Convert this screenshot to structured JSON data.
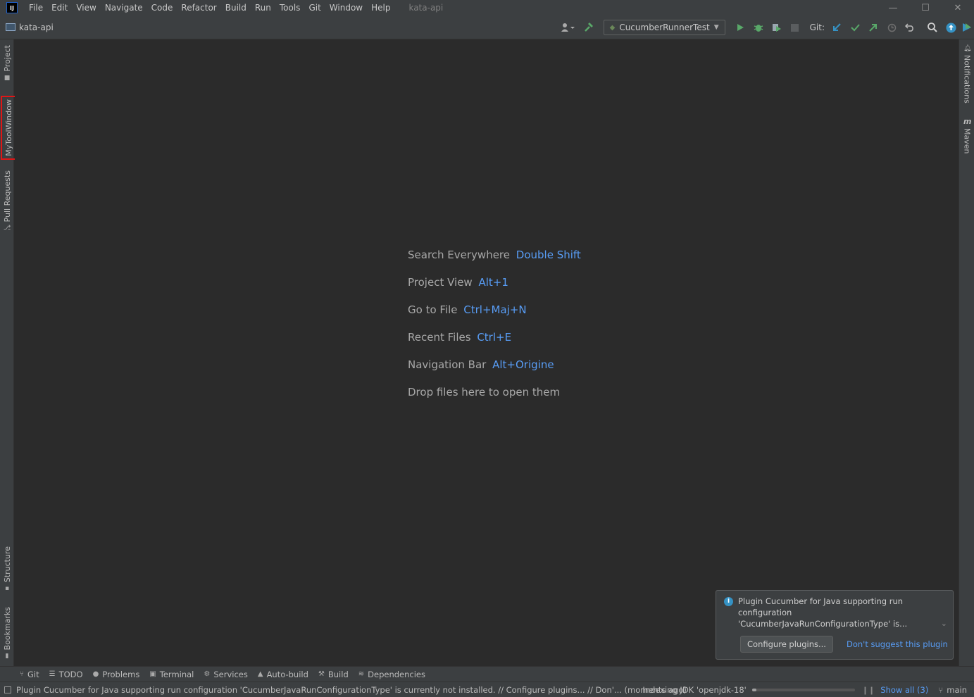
{
  "app": {
    "logo": "IJ",
    "title": "kata-api"
  },
  "menu": [
    "File",
    "Edit",
    "View",
    "Navigate",
    "Code",
    "Refactor",
    "Build",
    "Run",
    "Tools",
    "Git",
    "Window",
    "Help"
  ],
  "window_controls": {
    "minimize": "—",
    "maximize": "☐",
    "close": "✕"
  },
  "navbar": {
    "project": "kata-api",
    "run_config": "CucumberRunnerTest",
    "git_label": "Git:"
  },
  "left_stripe": {
    "project": "Project",
    "mytoolwindow": "MyToolWindow",
    "pull_requests": "Pull Requests",
    "structure": "Structure",
    "bookmarks": "Bookmarks"
  },
  "right_stripe": {
    "notifications": "Notifications",
    "maven": "Maven",
    "maven_glyph": "m"
  },
  "hints": [
    {
      "label": "Search Everywhere",
      "key": "Double Shift"
    },
    {
      "label": "Project View",
      "key": "Alt+1"
    },
    {
      "label": "Go to File",
      "key": "Ctrl+Maj+N"
    },
    {
      "label": "Recent Files",
      "key": "Ctrl+E"
    },
    {
      "label": "Navigation Bar",
      "key": "Alt+Origine"
    },
    {
      "label": "Drop files here to open them",
      "key": ""
    }
  ],
  "notification": {
    "text": "Plugin Cucumber for Java supporting run configuration 'CucumberJavaRunConfigurationType' is...",
    "button": "Configure plugins...",
    "link": "Don't suggest this plugin"
  },
  "bottom_tools": [
    "Git",
    "TODO",
    "Problems",
    "Terminal",
    "Services",
    "Auto-build",
    "Build",
    "Dependencies"
  ],
  "status": {
    "message": "Plugin Cucumber for Java supporting run configuration 'CucumberJavaRunConfigurationType' is currently not installed. // Configure plugins... // Don'... (moments ago)",
    "indexing": "Indexing JDK 'openjdk-18'",
    "indexing_progress": 0.04,
    "show_all": "Show all (3)",
    "branch": "main"
  },
  "colors": {
    "accent": "#589df6",
    "background": "#2b2b2b",
    "panel": "#3c3f41",
    "highlight": "#e01616"
  }
}
